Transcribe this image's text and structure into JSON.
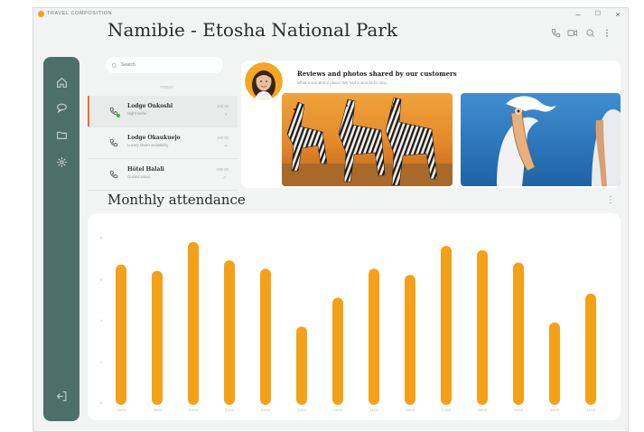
{
  "app": {
    "name": "TRAVEL COMPOSITION"
  },
  "window_controls": {
    "minimize": "–",
    "maximize": "☐",
    "close": "×"
  },
  "header": {
    "title": "Namibie - Etosha National Park"
  },
  "search": {
    "placeholder": "Search"
  },
  "list": {
    "date_label": "TODAY",
    "items": [
      {
        "name": "Lodge Onkoshi",
        "subtitle": "Night safari",
        "time": "10h 30",
        "flag": "•",
        "online": true
      },
      {
        "name": "Lodge Okaukuejo",
        "subtitle": "Luxury chalet availability",
        "time": "10h 45",
        "flag": "•",
        "online": false
      },
      {
        "name": "Hôtel Halali",
        "subtitle": "Guided safari",
        "time": "09h 00",
        "flag": "✓",
        "online": false
      }
    ]
  },
  "reviews": {
    "title": "Reviews and photos shared by our customers",
    "subtitle": "What a wonderful place! We had a wonderful stay..."
  },
  "attendance": {
    "title": "Monthly attendance"
  },
  "chart_data": {
    "type": "bar",
    "categories": [
      "19/03",
      "19/03",
      "20/03",
      "21/03",
      "22/03",
      "23/03",
      "23/03",
      "24/03",
      "26/03",
      "27/03",
      "28/03",
      "29/03",
      "30/03",
      "31/03"
    ],
    "values": [
      6.7,
      6.4,
      7.8,
      6.9,
      6.5,
      3.7,
      5.1,
      6.5,
      6.2,
      7.6,
      7.4,
      6.8,
      3.9,
      5.3
    ],
    "yticks": [
      0,
      2,
      4,
      6,
      8
    ],
    "ylim": [
      0,
      8
    ],
    "bar_color": "#f4a119",
    "grid": false
  },
  "colors": {
    "sidebar": "#4d6f6a",
    "accent": "#f4a119",
    "active_marker": "#f26b2e",
    "online": "#3ab54a"
  },
  "icons": {
    "top": [
      "phone-icon",
      "video-icon",
      "search-icon",
      "more-vertical-icon"
    ],
    "sidebar": [
      "home-icon",
      "chat-icon",
      "folder-icon",
      "settings-icon",
      "logout-icon"
    ]
  }
}
